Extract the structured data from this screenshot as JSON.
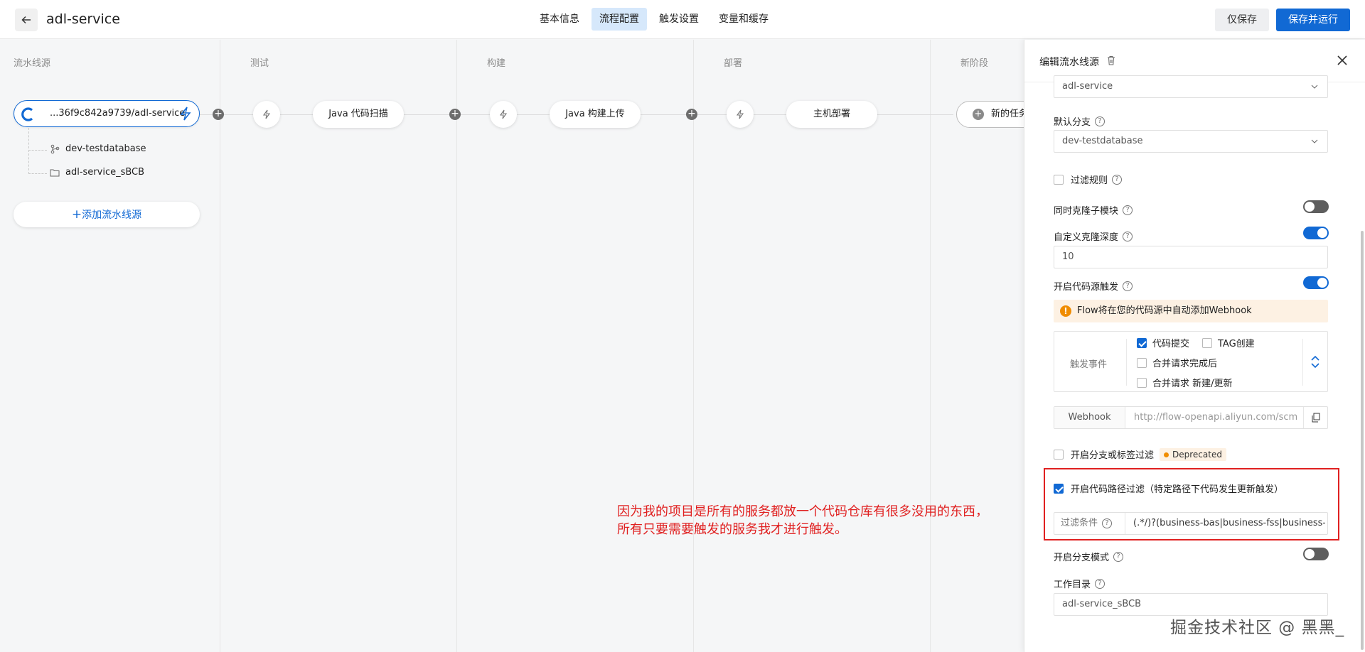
{
  "header": {
    "back_icon": "arrow-left-icon",
    "title": "adl-service",
    "tabs": [
      "基本信息",
      "流程配置",
      "触发设置",
      "变量和缓存"
    ],
    "active_tab": "流程配置",
    "save_only_label": "仅保存",
    "save_run_label": "保存并运行"
  },
  "pipeline": {
    "stages": [
      "流水线源",
      "测试",
      "构建",
      "部署",
      "新阶段"
    ],
    "source": {
      "name": "...36f9c842a9739/adl-service",
      "branch": "dev-testdatabase",
      "folder": "adl-service_sBCB"
    },
    "add_source_label": "添加流水线源",
    "jobs": [
      "Java 代码扫描",
      "Java 构建上传",
      "主机部署"
    ],
    "new_task_label": "新的任务",
    "annotation_line1": "因为我的项目是所有的服务都放一个代码仓库有很多没用的东西，",
    "annotation_line2": "所有只要需要触发的服务我才进行触发。"
  },
  "panel": {
    "title": "编辑流水线源",
    "repo_value": "adl-service",
    "default_branch_label": "默认分支",
    "default_branch_value": "dev-testdatabase",
    "filter_rule_label": "过滤规则",
    "clone_submodule_label": "同时克隆子模块",
    "clone_depth_label": "自定义克隆深度",
    "clone_depth_value": "10",
    "code_trigger_label": "开启代码源触发",
    "warning_text": "Flow将在您的代码源中自动添加Webhook",
    "trigger_events_label": "触发事件",
    "event_commit": "代码提交",
    "event_tag": "TAG创建",
    "event_merge_done": "合并请求完成后",
    "event_merge_new": "合并请求 新建/更新",
    "webhook_label": "Webhook",
    "webhook_url": "http://flow-openapi.aliyun.com/scm",
    "branch_tag_filter_label": "开启分支或标签过滤",
    "deprecated_badge": "Deprecated",
    "path_filter_label": "开启代码路径过滤（特定路径下代码发生更新触发）",
    "filter_condition_label": "过滤条件",
    "filter_condition_value": "(.*/)?(business-bas|business-fss|business-o",
    "branch_mode_label": "开启分支模式",
    "workdir_label": "工作目录",
    "workdir_value": "adl-service_sBCB",
    "toggles": {
      "clone_submodule": false,
      "clone_depth": true,
      "code_trigger": true,
      "branch_mode": false
    },
    "checks": {
      "filter_rule": false,
      "commit": true,
      "tag": false,
      "merge_done": false,
      "merge_new": false,
      "branch_tag_filter": false,
      "path_filter": true
    }
  },
  "watermark": "掘金技术社区 @ 黑黑_",
  "colors": {
    "accent": "#1169d4",
    "annotation": "#e02020",
    "warning": "#f08c00"
  }
}
